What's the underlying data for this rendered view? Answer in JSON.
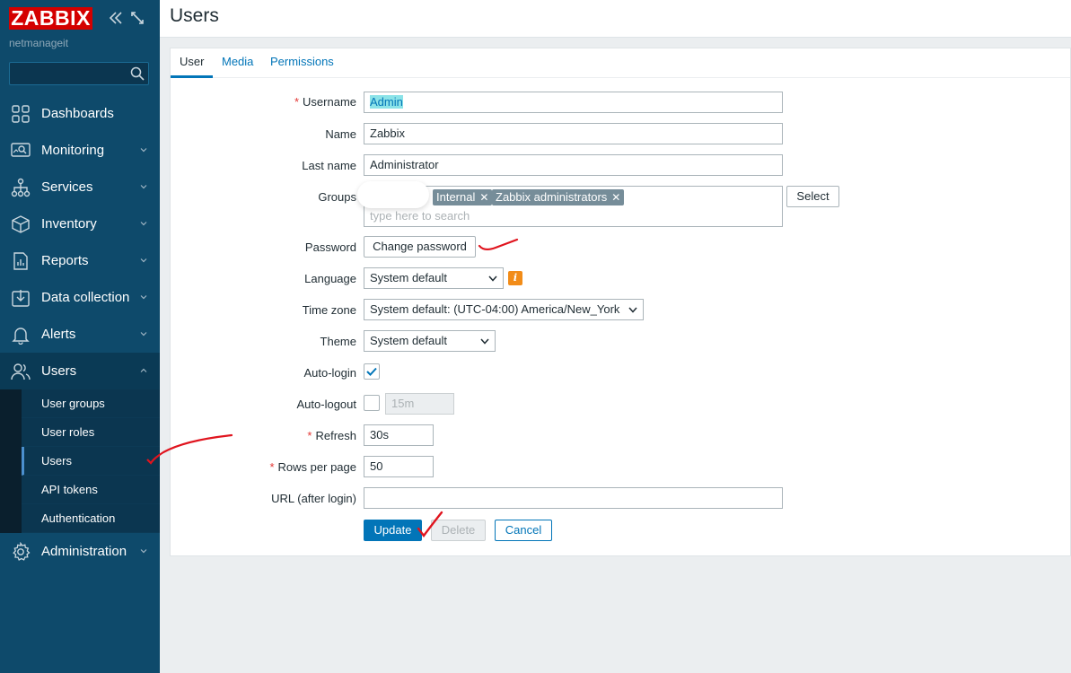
{
  "sidebar": {
    "logo": "ZABBIX",
    "server_name": "netmanageit",
    "search_value": "",
    "items": [
      {
        "label": "Dashboards",
        "icon": "dashboards-icon"
      },
      {
        "label": "Monitoring",
        "icon": "monitoring-icon"
      },
      {
        "label": "Services",
        "icon": "services-icon"
      },
      {
        "label": "Inventory",
        "icon": "inventory-icon"
      },
      {
        "label": "Reports",
        "icon": "reports-icon"
      },
      {
        "label": "Data collection",
        "icon": "data-collection-icon"
      },
      {
        "label": "Alerts",
        "icon": "alerts-icon"
      },
      {
        "label": "Users",
        "icon": "users-icon"
      },
      {
        "label": "Administration",
        "icon": "administration-icon"
      }
    ],
    "users_submenu": [
      "User groups",
      "User roles",
      "Users",
      "API tokens",
      "Authentication"
    ]
  },
  "page": {
    "title": "Users"
  },
  "tabs": [
    "User",
    "Media",
    "Permissions"
  ],
  "form": {
    "username_label": "Username",
    "username_value": "Admin",
    "name_label": "Name",
    "name_value": "Zabbix",
    "lastname_label": "Last name",
    "lastname_value": "Administrator",
    "groups_label": "Groups",
    "groups": [
      "Internal",
      "Zabbix administrators"
    ],
    "groups_placeholder": "type here to search",
    "select_button": "Select",
    "password_label": "Password",
    "change_password_button": "Change password",
    "language_label": "Language",
    "language_value": "System default",
    "timezone_label": "Time zone",
    "timezone_value": "System default: (UTC-04:00) America/New_York",
    "theme_label": "Theme",
    "theme_value": "System default",
    "autologin_label": "Auto-login",
    "autologin_checked": true,
    "autologout_label": "Auto-logout",
    "autologout_checked": false,
    "autologout_value": "15m",
    "refresh_label": "Refresh",
    "refresh_value": "30s",
    "rows_label": "Rows per page",
    "rows_value": "50",
    "url_label": "URL (after login)",
    "url_value": "",
    "update_button": "Update",
    "delete_button": "Delete",
    "cancel_button": "Cancel"
  },
  "colors": {
    "sidebar_bg": "#0e4a6b",
    "brand_red": "#d40000",
    "accent_blue": "#0275b8",
    "annotation_red": "#e0141e"
  }
}
